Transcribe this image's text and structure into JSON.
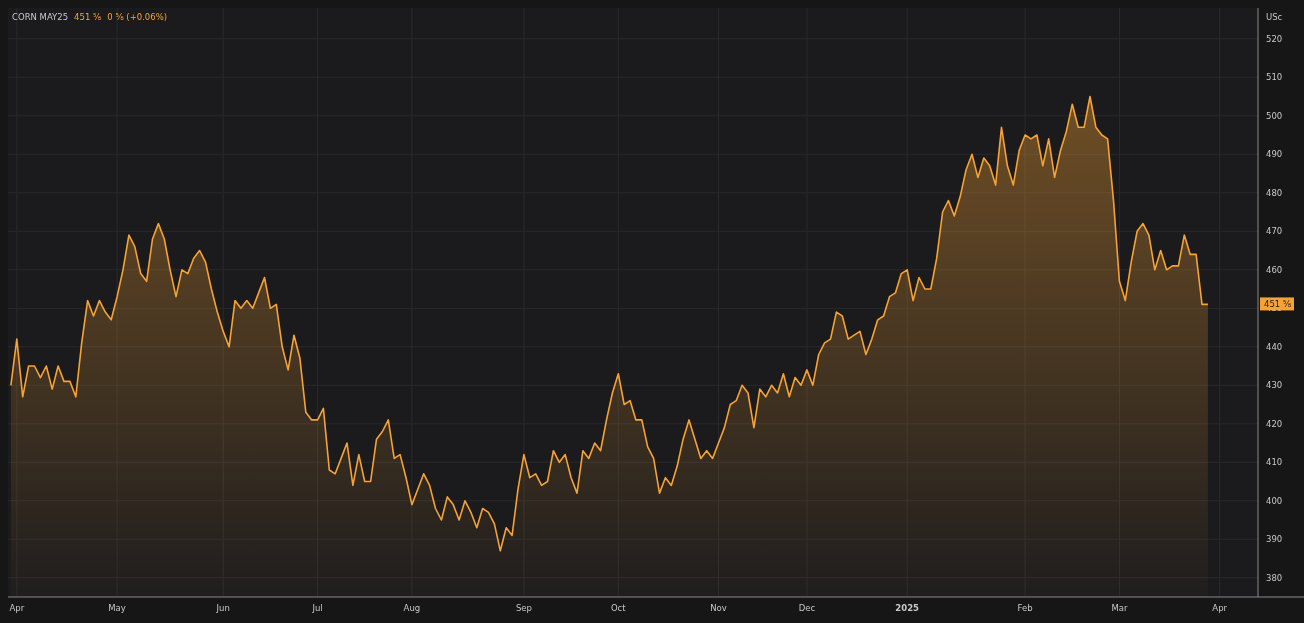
{
  "header": {
    "last": "451 ⅝",
    "change": "0 ⅝ (+0.06%)"
  },
  "chart": {
    "unit": "USc",
    "price_badge": "451 ⅝",
    "chart_data": {
      "type": "area",
      "grid": true,
      "ylim": [
        375,
        528
      ],
      "categories": [
        null,
        "Apr",
        null,
        null,
        null,
        null,
        null,
        null,
        null,
        null,
        null,
        null,
        null,
        null,
        null,
        null,
        null,
        null,
        "May",
        null,
        null,
        null,
        null,
        null,
        null,
        null,
        null,
        null,
        null,
        null,
        null,
        null,
        null,
        null,
        null,
        null,
        "Jun",
        null,
        null,
        null,
        null,
        null,
        null,
        null,
        null,
        null,
        null,
        null,
        null,
        null,
        null,
        null,
        "Jul",
        null,
        null,
        null,
        null,
        null,
        null,
        null,
        null,
        null,
        null,
        null,
        null,
        null,
        null,
        null,
        "Aug",
        null,
        null,
        null,
        null,
        null,
        null,
        null,
        null,
        null,
        null,
        null,
        null,
        null,
        null,
        null,
        null,
        null,
        null,
        "Sep",
        null,
        null,
        null,
        null,
        null,
        null,
        null,
        null,
        null,
        null,
        null,
        null,
        null,
        null,
        null,
        "Oct",
        null,
        null,
        null,
        null,
        null,
        null,
        null,
        null,
        null,
        null,
        null,
        null,
        null,
        null,
        null,
        null,
        "Nov",
        null,
        null,
        null,
        null,
        null,
        null,
        null,
        null,
        null,
        null,
        null,
        null,
        null,
        null,
        "Dec",
        null,
        null,
        null,
        null,
        null,
        null,
        null,
        null,
        null,
        null,
        null,
        null,
        null,
        null,
        null,
        null,
        "2025",
        null,
        null,
        null,
        null,
        null,
        null,
        null,
        null,
        null,
        null,
        null,
        null,
        null,
        null,
        null,
        null,
        null,
        null,
        null,
        "Feb",
        null,
        null,
        null,
        null,
        null,
        null,
        null,
        null,
        null,
        null,
        null,
        null,
        null,
        null,
        null,
        "Mar",
        null,
        null,
        null,
        null,
        null,
        null,
        null,
        null,
        null,
        null,
        null,
        null,
        null,
        null,
        null,
        null,
        "Apr",
        null,
        null,
        null,
        null,
        null,
        null
      ],
      "series": [
        {
          "name": "CORN MAY25",
          "color": "#f7a234",
          "values": [
            430,
            442,
            427,
            435,
            435,
            432,
            435,
            429,
            435,
            431,
            431,
            427,
            441,
            452,
            448,
            452,
            449,
            447,
            453,
            460,
            469,
            466,
            459,
            457,
            468,
            472,
            468,
            460,
            453,
            460,
            459,
            463,
            465,
            462,
            455,
            449,
            444,
            440,
            452,
            450,
            452,
            450,
            454,
            458,
            450,
            451,
            440,
            434,
            443,
            437,
            423,
            421,
            421,
            424,
            408,
            407,
            411,
            415,
            404,
            412,
            405,
            405,
            416,
            418,
            421,
            411,
            412,
            406,
            399,
            403,
            407,
            404,
            398,
            395,
            401,
            399,
            395,
            400,
            397,
            393,
            398,
            397,
            394,
            387,
            393,
            391,
            403,
            412,
            406,
            407,
            404,
            405,
            413,
            410,
            412,
            406,
            402,
            413,
            411,
            415,
            413,
            421,
            428,
            433,
            425,
            426,
            421,
            421,
            414,
            411,
            402,
            406,
            404,
            409,
            416,
            421,
            416,
            411,
            413,
            411,
            415,
            419,
            425,
            426,
            430,
            428,
            419,
            429,
            427,
            430,
            428,
            433,
            427,
            432,
            430,
            434,
            430,
            438,
            441,
            442,
            449,
            448,
            442,
            443,
            444,
            438,
            442,
            447,
            448,
            453,
            454,
            459,
            460,
            452,
            458,
            455,
            455,
            463,
            475,
            478,
            474,
            479,
            486,
            490,
            484,
            489,
            487,
            482,
            497,
            487,
            482,
            491,
            495,
            494,
            495,
            487,
            494,
            484,
            491,
            496,
            503,
            497,
            497,
            505,
            497,
            495,
            494,
            478,
            457,
            452,
            462,
            470,
            472,
            469,
            460,
            465,
            460,
            461,
            461,
            469,
            464,
            464,
            451,
            451,
            null,
            null,
            null,
            null,
            null,
            null,
            null,
            null
          ]
        }
      ],
      "yticks": [
        380,
        390,
        400,
        410,
        420,
        430,
        440,
        450,
        460,
        470,
        480,
        490,
        500,
        510,
        520
      ]
    }
  }
}
